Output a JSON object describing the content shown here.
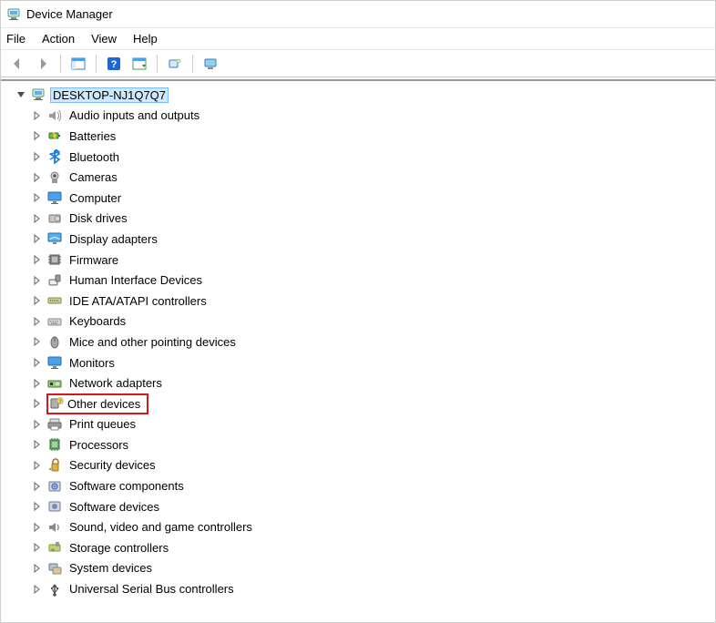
{
  "window": {
    "title": "Device Manager"
  },
  "menu": {
    "file": "File",
    "action": "Action",
    "view": "View",
    "help": "Help"
  },
  "toolbar": {
    "back": "Back",
    "forward": "Forward",
    "show_hide": "Show/Hide Console Tree",
    "help": "Help",
    "action_menu": "Action",
    "scan": "Scan for hardware changes",
    "monitor": "Add legacy hardware"
  },
  "tree": {
    "root": "DESKTOP-NJ1Q7Q7",
    "items": [
      {
        "label": "Audio inputs and outputs",
        "icon": "speaker"
      },
      {
        "label": "Batteries",
        "icon": "battery"
      },
      {
        "label": "Bluetooth",
        "icon": "bluetooth"
      },
      {
        "label": "Cameras",
        "icon": "camera"
      },
      {
        "label": "Computer",
        "icon": "monitor"
      },
      {
        "label": "Disk drives",
        "icon": "disk"
      },
      {
        "label": "Display adapters",
        "icon": "display"
      },
      {
        "label": "Firmware",
        "icon": "firmware"
      },
      {
        "label": "Human Interface Devices",
        "icon": "hid"
      },
      {
        "label": "IDE ATA/ATAPI controllers",
        "icon": "ide"
      },
      {
        "label": "Keyboards",
        "icon": "keyboard"
      },
      {
        "label": "Mice and other pointing devices",
        "icon": "mouse"
      },
      {
        "label": "Monitors",
        "icon": "monitor"
      },
      {
        "label": "Network adapters",
        "icon": "network"
      },
      {
        "label": "Other devices",
        "icon": "other",
        "highlighted": true
      },
      {
        "label": "Print queues",
        "icon": "printer"
      },
      {
        "label": "Processors",
        "icon": "cpu"
      },
      {
        "label": "Security devices",
        "icon": "security"
      },
      {
        "label": "Software components",
        "icon": "softcomp"
      },
      {
        "label": "Software devices",
        "icon": "softdev"
      },
      {
        "label": "Sound, video and game controllers",
        "icon": "sound"
      },
      {
        "label": "Storage controllers",
        "icon": "storage"
      },
      {
        "label": "System devices",
        "icon": "system"
      },
      {
        "label": "Universal Serial Bus controllers",
        "icon": "usb"
      }
    ]
  }
}
